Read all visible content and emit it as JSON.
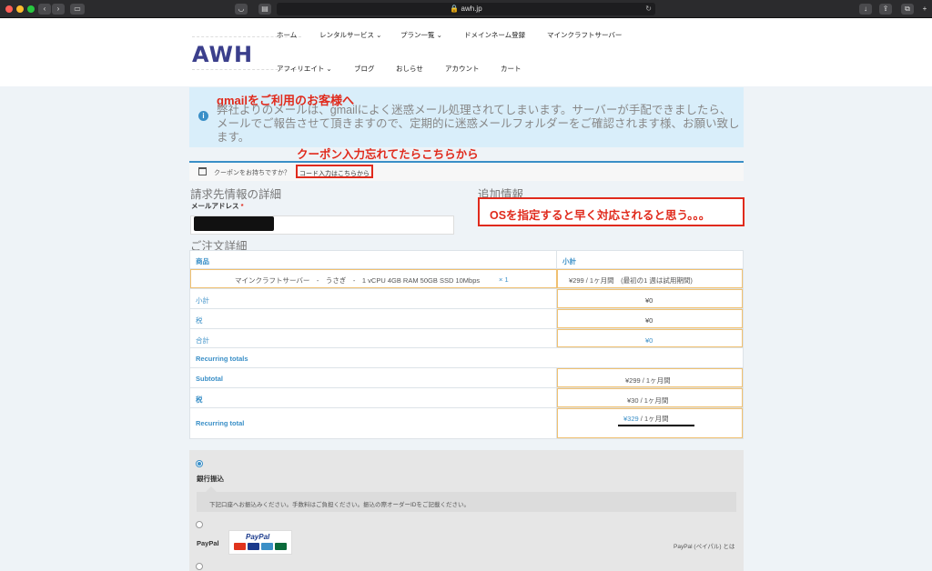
{
  "browser": {
    "url": "awh.jp"
  },
  "header": {
    "logo": "AWH",
    "nav_row1": [
      "ホーム",
      "レンタルサービス ⌄",
      "プラン一覧 ⌄",
      "ドメインネーム登録",
      "マインクラフトサーバー"
    ],
    "nav_row2": [
      "アフィリエイト ⌄",
      "ブログ",
      "おしらせ",
      "アカウント",
      "カート"
    ]
  },
  "notice": {
    "annotation": "gmailをご利用のお客様へ",
    "message": "弊社よりのメールは、gmailによく迷惑メール処理されてしまいます。サーバーが手配できましたら、メールでご報告させて頂きますので、定期的に迷惑メールフォルダーをご確認されます様、お願い致します。"
  },
  "coupon": {
    "annotation": "クーポン入力忘れてたらこちらから",
    "question": "クーポンをお持ちですか？",
    "link": "コード入力はこちらから"
  },
  "billing": {
    "heading": "請求先情報の詳細",
    "email_label": "メールアドレス",
    "required_mark": "*"
  },
  "additional": {
    "heading": "追加情報",
    "annotation": "OSを指定すると早く対応されると思う。。。"
  },
  "order": {
    "heading": "ご注文詳細",
    "col_product": "商品",
    "col_subtotal": "小計",
    "item_name": "マインクラフトサーバー　-　うさぎ　-　1 vCPU 4GB RAM 50GB SSD 10Mbps",
    "item_qty": "× 1",
    "item_price": "¥299 / 1ヶ月間　(最初の1 週は試用期間)",
    "subtotal_label": "小計",
    "subtotal_value": "¥0",
    "tax_label": "税",
    "tax_value": "¥0",
    "total_label": "合計",
    "total_value": "¥0",
    "recurring_heading": "Recurring totals",
    "r_subtotal_label": "Subtotal",
    "r_subtotal_value": "¥299 / 1ヶ月間",
    "r_tax_label": "税",
    "r_tax_value": "¥30 / 1ヶ月間",
    "r_total_label": "Recurring total",
    "r_total_amount": "¥329",
    "r_total_period": " / 1ヶ月間"
  },
  "payment": {
    "bank_label": "銀行振込",
    "bank_desc": "下記口座へお振込みください。手数料はご負担ください。振込の際オーダーIDをご記載ください。",
    "paypal_label": "PayPal",
    "paypal_logo": "PayPal",
    "paypal_link": "PayPal (ペイパル) とは"
  },
  "colors": {
    "accent": "#3a8fc7",
    "annotation_red": "#e02a1c",
    "notice_bg": "#d9eefa"
  }
}
